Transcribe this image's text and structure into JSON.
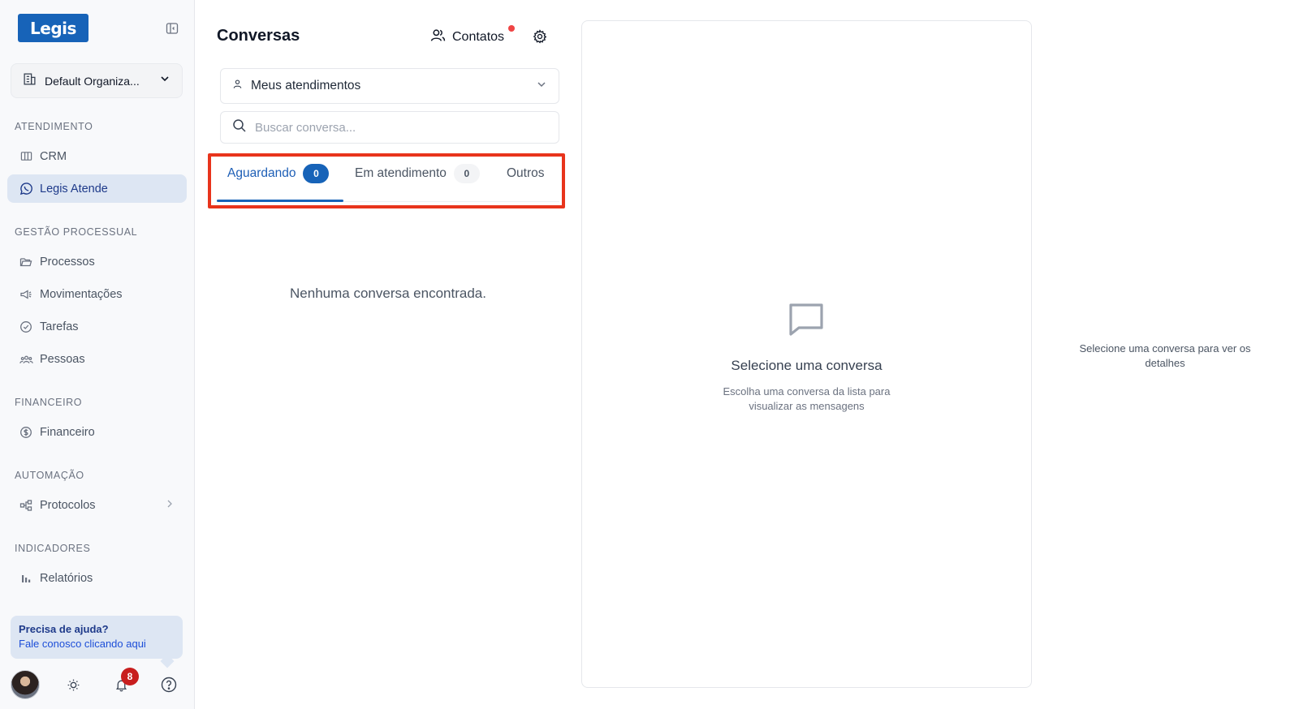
{
  "sidebar": {
    "logo_text": "Legis",
    "organization": "Default Organiza...",
    "sections": {
      "atendimento": "ATENDIMENTO",
      "gestao": "GESTÃO PROCESSUAL",
      "financeiro": "FINANCEIRO",
      "automacao": "AUTOMAÇÃO",
      "indicadores": "INDICADORES"
    },
    "items": {
      "crm": "CRM",
      "legis_atende": "Legis Atende",
      "processos": "Processos",
      "movimentacoes": "Movimentações",
      "tarefas": "Tarefas",
      "pessoas": "Pessoas",
      "financeiro": "Financeiro",
      "protocolos": "Protocolos",
      "relatorios": "Relatórios"
    },
    "help": {
      "title": "Precisa de ajuda?",
      "link": "Fale conosco clicando aqui"
    },
    "notifications_count": "8"
  },
  "conversations": {
    "title": "Conversas",
    "contacts_label": "Contatos",
    "filter_label": "Meus atendimentos",
    "search_placeholder": "Buscar conversa...",
    "tabs": [
      {
        "label": "Aguardando",
        "count": "0"
      },
      {
        "label": "Em atendimento",
        "count": "0"
      },
      {
        "label": "Outros"
      }
    ],
    "empty_text": "Nenhuma conversa encontrada."
  },
  "message_panel": {
    "title": "Selecione uma conversa",
    "subtitle": "Escolha uma conversa da lista para visualizar as mensagens"
  },
  "details_panel": {
    "hint": "Selecione uma conversa para ver os detalhes"
  },
  "colors": {
    "brand": "#1763b8",
    "highlight": "#e8341c",
    "notification": "#c81e1e"
  }
}
